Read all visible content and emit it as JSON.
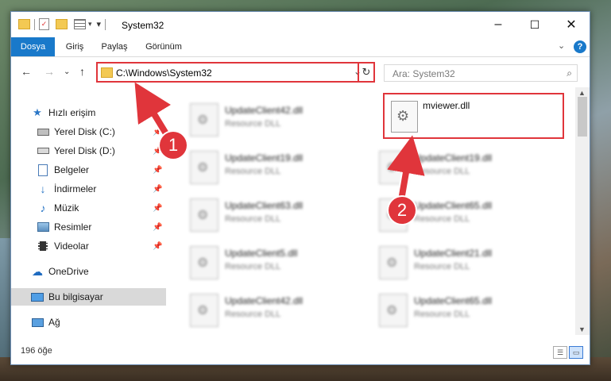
{
  "window": {
    "title": "System32",
    "controls": {
      "minimize": "–",
      "maximize": "☐",
      "close": "✕"
    }
  },
  "ribbon": {
    "tabs": [
      {
        "label": "Dosya",
        "active": true
      },
      {
        "label": "Giriş"
      },
      {
        "label": "Paylaş"
      },
      {
        "label": "Görünüm"
      }
    ],
    "help_label": "?"
  },
  "navigation": {
    "address": "C:\\Windows\\System32",
    "search_placeholder": "Ara: System32"
  },
  "sidebar": {
    "items": [
      {
        "label": "Hızlı erişim",
        "icon": "star-icon"
      },
      {
        "label": "Yerel Disk (C:)",
        "icon": "drive-icon",
        "pinned": true
      },
      {
        "label": "Yerel Disk (D:)",
        "icon": "drive-icon",
        "pinned": true
      },
      {
        "label": "Belgeler",
        "icon": "documents-icon",
        "pinned": true
      },
      {
        "label": "İndirmeler",
        "icon": "download-icon",
        "pinned": true
      },
      {
        "label": "Müzik",
        "icon": "music-icon",
        "pinned": true
      },
      {
        "label": "Resimler",
        "icon": "pictures-icon",
        "pinned": true
      },
      {
        "label": "Videolar",
        "icon": "videos-icon",
        "pinned": true
      },
      {
        "label": "OneDrive",
        "icon": "cloud-icon"
      },
      {
        "label": "Bu bilgisayar",
        "icon": "computer-icon",
        "selected": true
      },
      {
        "label": "Ağ",
        "icon": "network-icon"
      }
    ]
  },
  "files": {
    "type_label": "Resource DLL",
    "left_column": [
      "UpdateClient42.dll",
      "UpdateClient19.dll",
      "UpdateClient63.dll",
      "UpdateClient5.dll",
      "UpdateClient42.dll"
    ],
    "right_column": [
      "UpdateClient19.dll",
      "UpdateClient65.dll",
      "UpdateClient21.dll",
      "UpdateClient65.dll"
    ],
    "highlighted_file": "mviewer.dll"
  },
  "status": {
    "item_count": "196 öğe"
  },
  "callouts": [
    "1",
    "2"
  ],
  "colors": {
    "accent": "#1979ca",
    "highlight": "#e0353b"
  }
}
